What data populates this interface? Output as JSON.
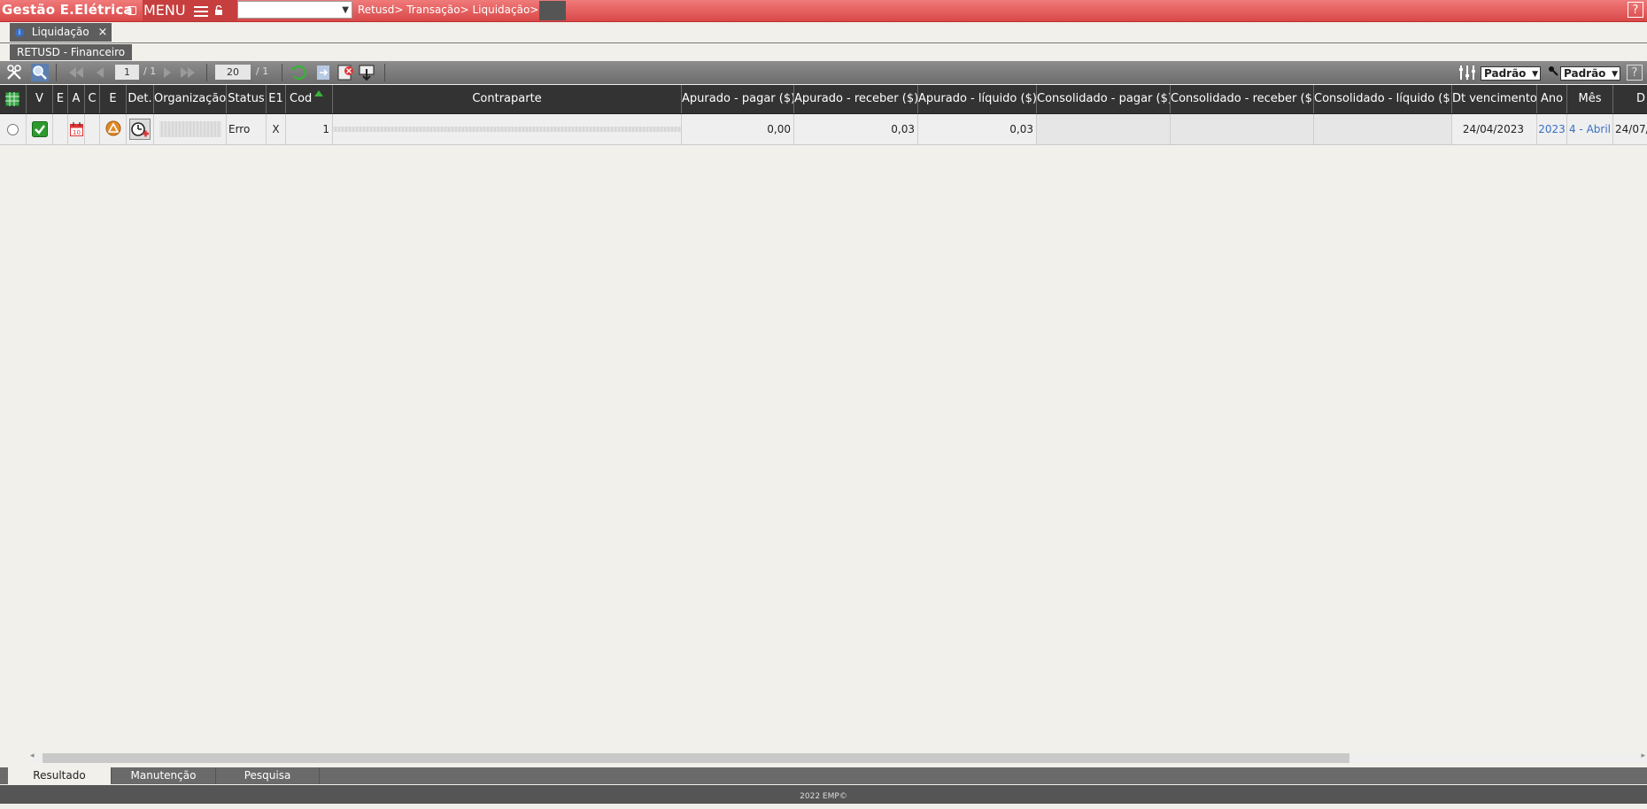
{
  "app": {
    "title": "Gestão E.Elétrica",
    "menu_label": "MENU",
    "breadcrumb": "Retusd> Transação> Liquidação>",
    "help_label": "?"
  },
  "tabs": {
    "active_tab": "Liquidação",
    "close_label": "×",
    "info_label": "i",
    "subtab": "RETUSD - Financeiro"
  },
  "toolbar": {
    "page_current": "1",
    "page_total": "/ 1",
    "page_size": "20",
    "page_size_total": "/ 1",
    "view_select": "Padrão",
    "filter_select": "Padrão",
    "help_label": "?"
  },
  "grid": {
    "headers": [
      "V",
      "E",
      "A",
      "C",
      "E",
      "Det.",
      "Organização",
      "Status",
      "E1",
      "Cod",
      "Contraparte",
      "Apurado - pagar ($)",
      "Apurado - receber ($)",
      "Apurado - líquido ($)",
      "Consolidado - pagar ($)",
      "Consolidado - receber ($)",
      "Consolidado - líquido ($)",
      "Dt vencimento",
      "Ano",
      "Mês",
      "D"
    ],
    "row": {
      "status": "Erro",
      "e1": "X",
      "cod": "1",
      "apurado_pagar": "0,00",
      "apurado_receber": "0,03",
      "apurado_liquido": "0,03",
      "dt_vencimento": "24/04/2023",
      "ano": "2023",
      "mes": "4 - Abril",
      "d": "24/07/"
    }
  },
  "bottom_tabs": [
    "Resultado",
    "Manutenção",
    "Pesquisa"
  ],
  "footer": "2022 EMP©",
  "colors": {
    "topbar": "#d94848",
    "header_bg": "#333333",
    "link": "#3a6fc4",
    "check_green": "#2e9a2e"
  }
}
